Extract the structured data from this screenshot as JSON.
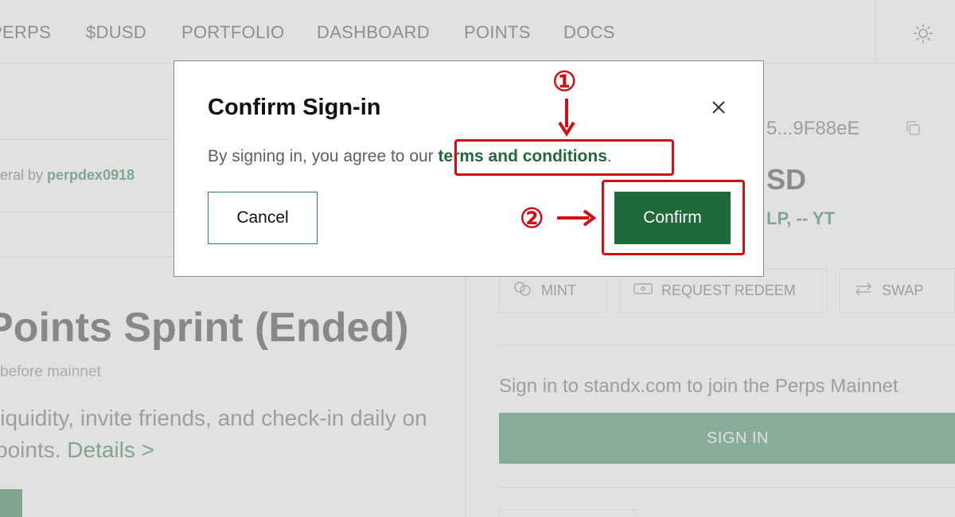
{
  "nav": {
    "items": [
      "PERPS",
      "$DUSD",
      "PORTFOLIO",
      "DASHBOARD",
      "POINTS",
      "DOCS"
    ],
    "theme_icon": "sun-icon"
  },
  "referral": {
    "prefix": "eral by",
    "user": "perpdex0918"
  },
  "sprint": {
    "title": "Points Sprint (Ended)",
    "subtitle": "before mainnet",
    "desc_line1": "liquidity, invite friends, and check-in daily on",
    "desc_line2": "points.",
    "details_link": "Details >"
  },
  "account": {
    "address": "5...9F88eE",
    "copy_icon": "copy-icon",
    "balance_unit": "SD",
    "lp_yt": "LP, -- YT"
  },
  "actions": {
    "mint": "MINT",
    "mint_icon": "coins-icon",
    "request_redeem": "REQUEST REDEEM",
    "redeem_icon": "ticket-icon",
    "swap": "SWAP",
    "swap_icon": "swap-arrows-icon"
  },
  "signin": {
    "hint": "Sign in to standx.com to join the Perps Mainnet",
    "button": "SIGN IN"
  },
  "modal": {
    "title": "Confirm Sign-in",
    "close_icon": "close-icon",
    "body_prefix": "By signing in, you agree to our",
    "terms_link": "terms and conditions",
    "body_suffix": ".",
    "cancel_label": "Cancel",
    "confirm_label": "Confirm"
  },
  "annotations": {
    "step1": "①",
    "step2": "②",
    "color": "#d10f17"
  },
  "colors": {
    "accent": "#1f6a3a",
    "annotation": "#d10f17"
  }
}
